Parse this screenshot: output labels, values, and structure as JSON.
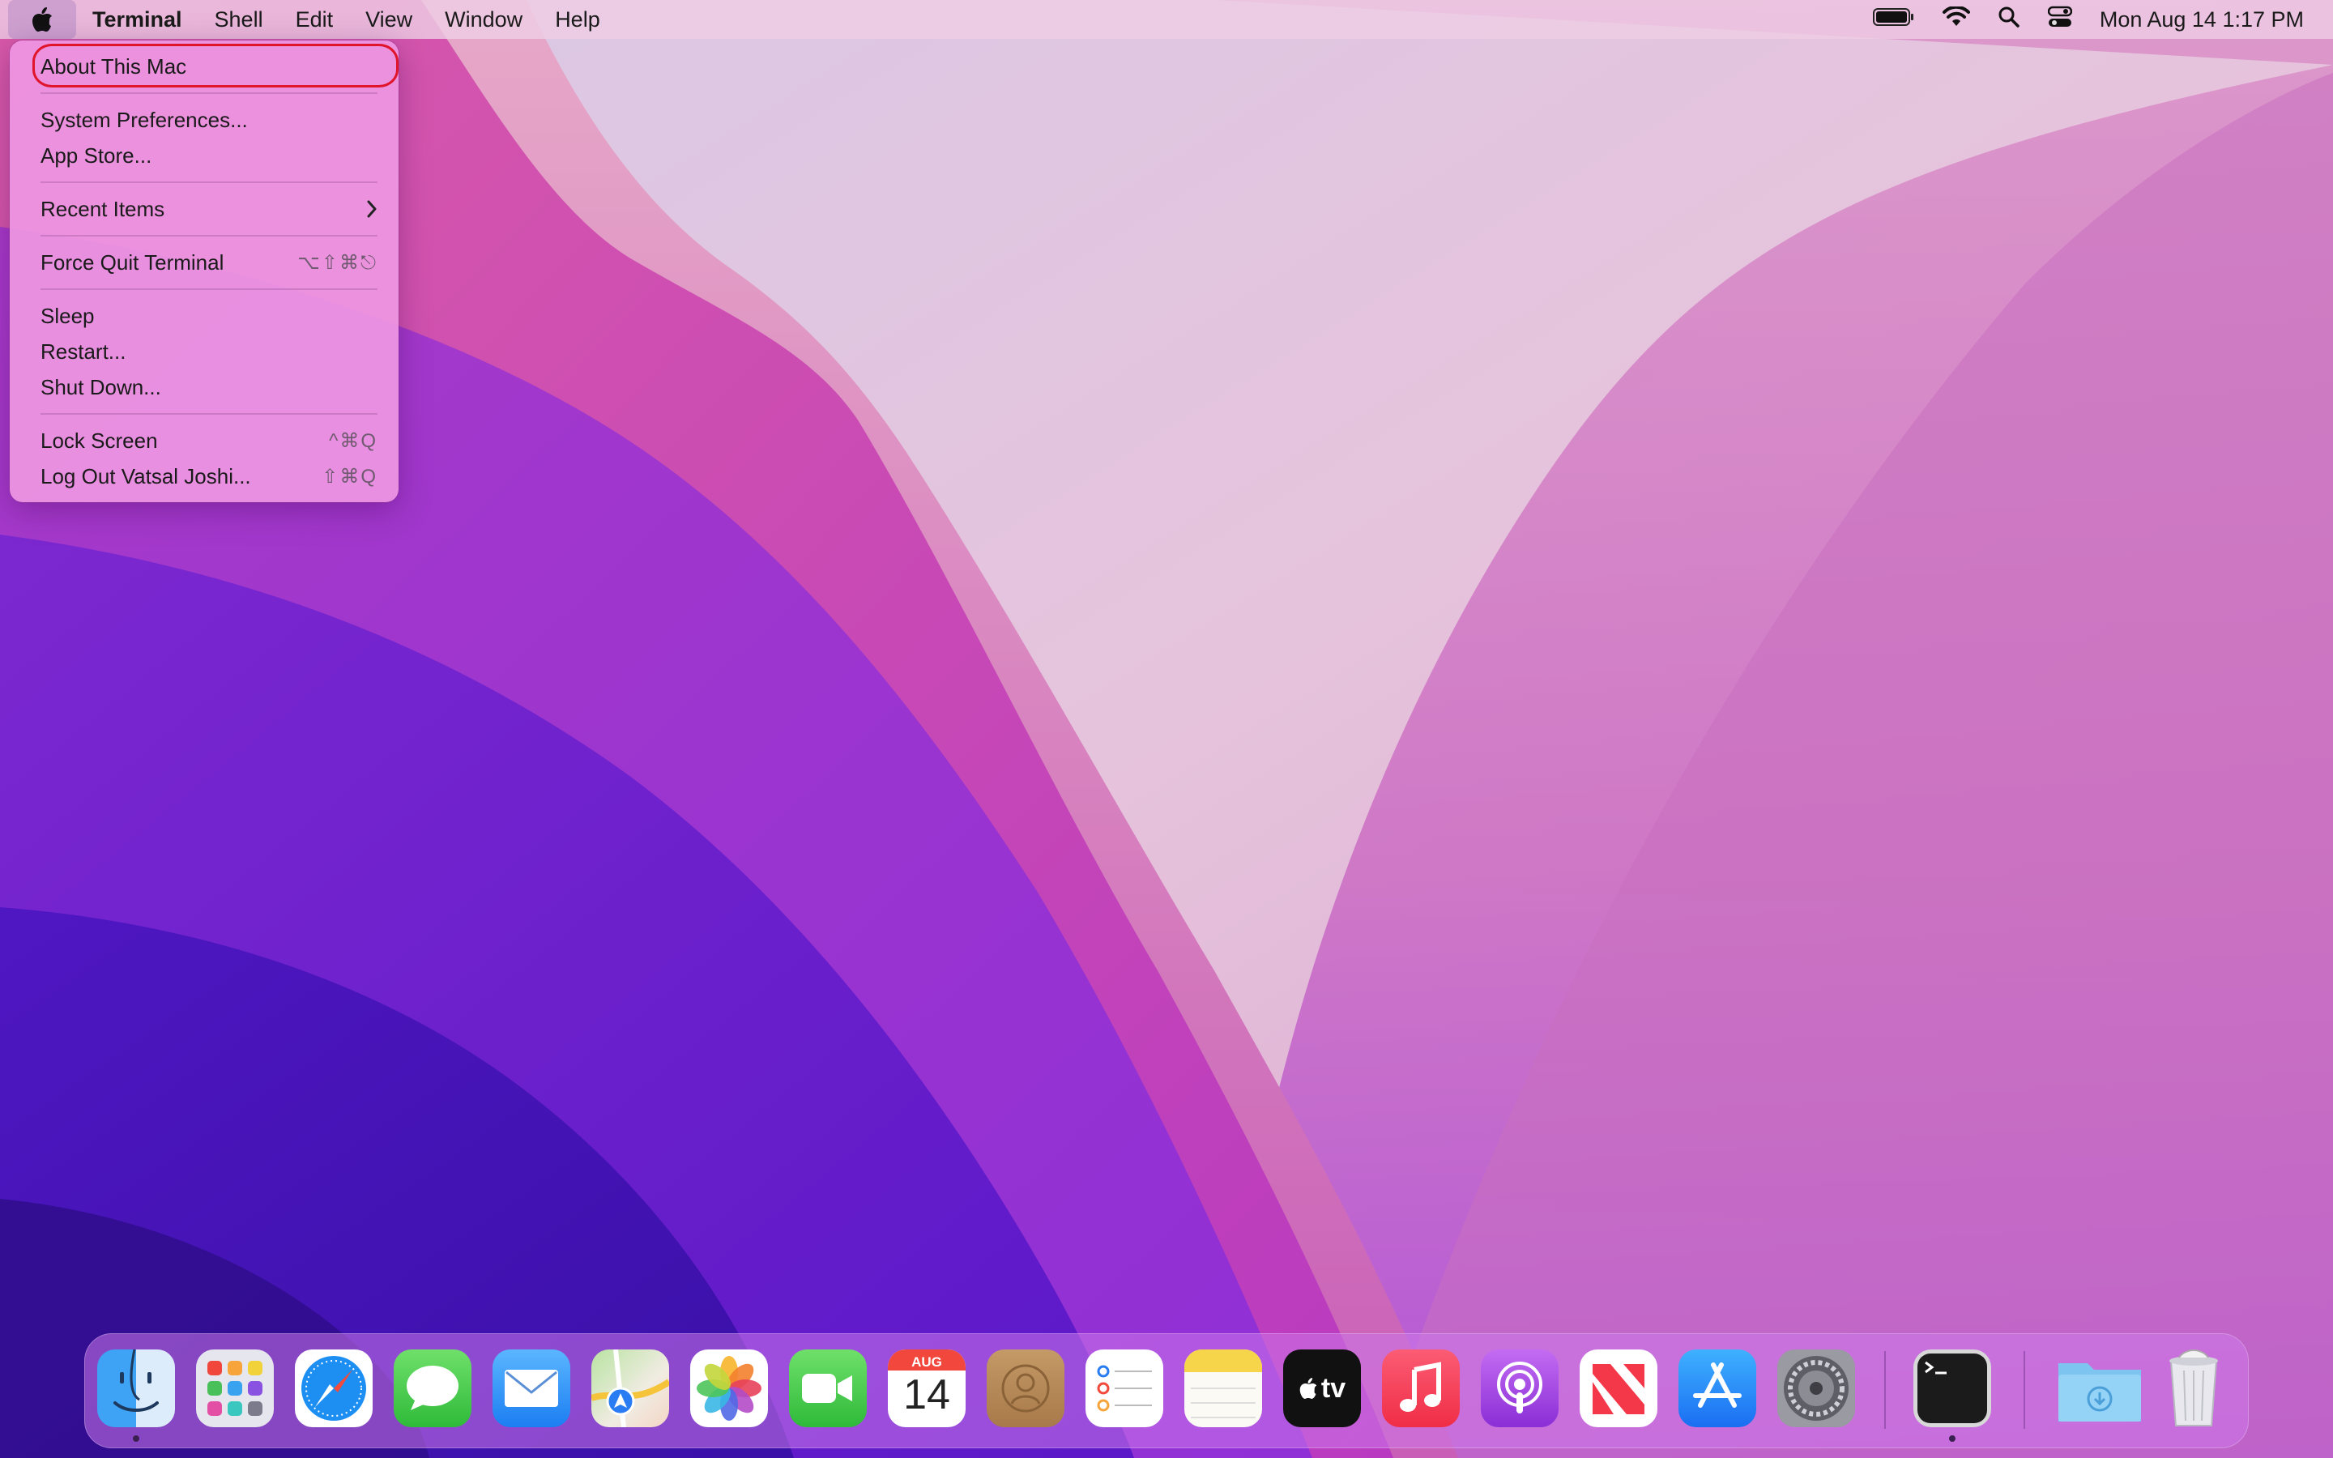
{
  "menubar": {
    "app_name": "Terminal",
    "menus": [
      "Shell",
      "Edit",
      "View",
      "Window",
      "Help"
    ],
    "clock": "Mon Aug 14  1:17 PM",
    "status_icons": [
      "battery-icon",
      "wifi-icon",
      "spotlight-search-icon",
      "control-center-icon"
    ]
  },
  "apple_menu": {
    "about": "About This Mac",
    "system_preferences": "System Preferences...",
    "app_store": "App Store...",
    "recent_items": "Recent Items",
    "force_quit": "Force Quit Terminal",
    "force_quit_shortcut": "⌥⇧⌘⎋",
    "sleep": "Sleep",
    "restart": "Restart...",
    "shut_down": "Shut Down...",
    "lock_screen": "Lock Screen",
    "lock_screen_shortcut": "^⌘Q",
    "log_out": "Log Out Vatsal Joshi...",
    "log_out_shortcut": "⇧⌘Q",
    "highlight_color": "#e0142a"
  },
  "dock": {
    "calendar_month": "AUG",
    "calendar_day": "14",
    "tv_label": "tv",
    "apps": [
      "Finder",
      "Launchpad",
      "Safari",
      "Messages",
      "Mail",
      "Maps",
      "Photos",
      "FaceTime",
      "Calendar",
      "Contacts",
      "Reminders",
      "Notes",
      "TV",
      "Music",
      "Podcasts",
      "News",
      "App Store",
      "System Preferences",
      "Terminal",
      "Downloads",
      "Trash"
    ],
    "running_apps": [
      "Finder",
      "Terminal"
    ]
  }
}
